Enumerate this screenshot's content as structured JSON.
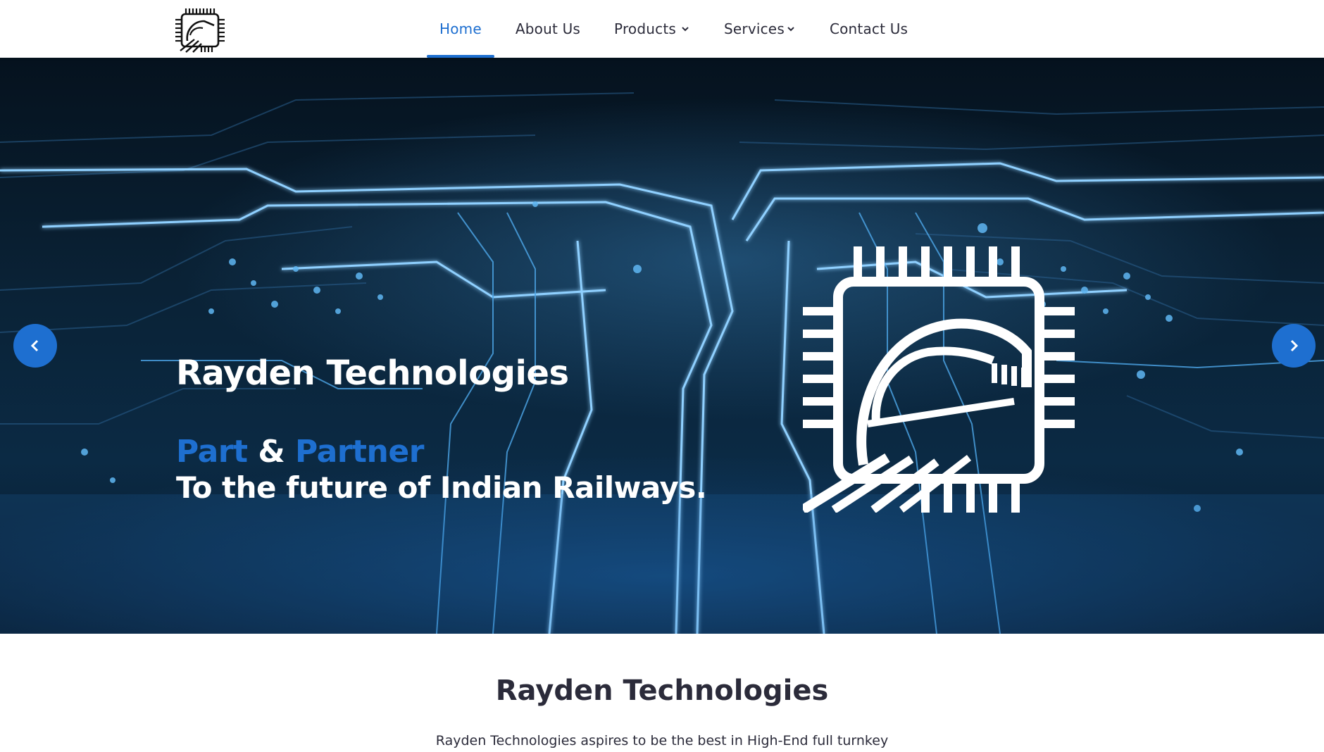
{
  "nav": {
    "items": [
      {
        "label": "Home",
        "active": true,
        "dropdown": false
      },
      {
        "label": "About Us",
        "active": false,
        "dropdown": false
      },
      {
        "label": "Products",
        "active": false,
        "dropdown": true
      },
      {
        "label": "Services",
        "active": false,
        "dropdown": true
      },
      {
        "label": "Contact Us",
        "active": false,
        "dropdown": false
      }
    ]
  },
  "hero": {
    "title": "Rayden Technologies",
    "tag_part": "Part",
    "tag_amp": "&",
    "tag_partner": "Partner",
    "subtitle": "To the future of Indian Railways."
  },
  "about": {
    "title": "Rayden Technologies",
    "text": "Rayden Technologies aspires to be the best in High-End full turnkey"
  },
  "icons": {
    "logo": "chip-train-logo",
    "prev": "chevron-left-icon",
    "next": "chevron-right-icon",
    "dropdown": "chevron-down-icon"
  },
  "colors": {
    "accent": "#1e6fd0",
    "text": "#2b2b3a",
    "hero_bg": "#0a2236"
  }
}
